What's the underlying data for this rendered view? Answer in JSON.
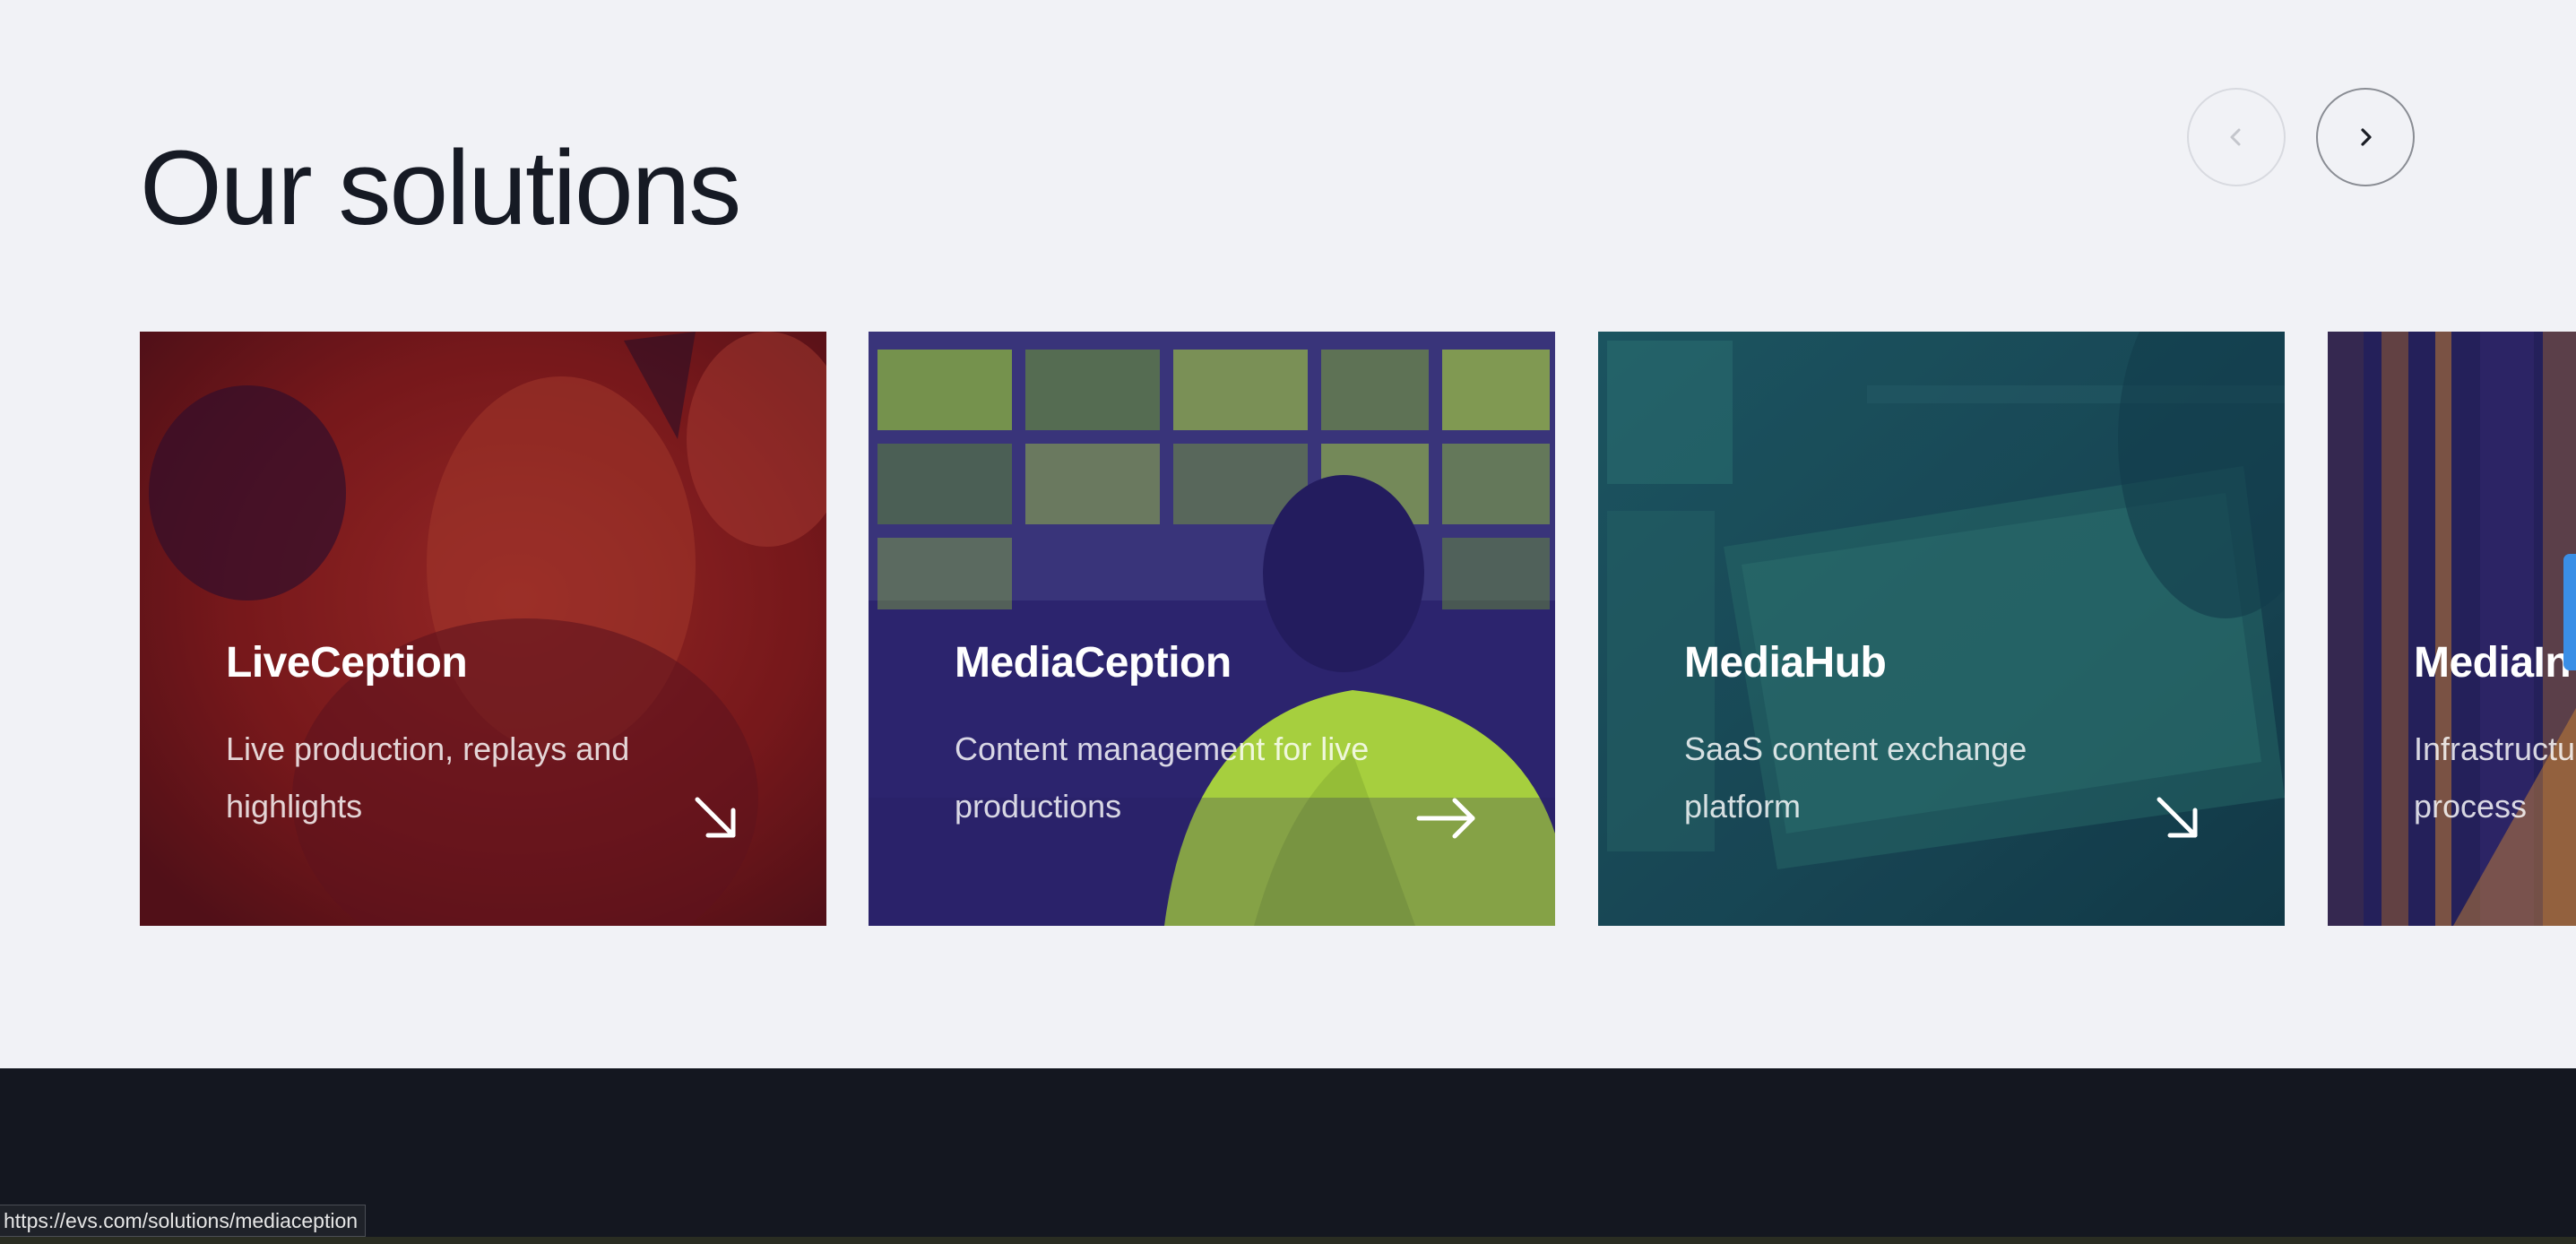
{
  "section": {
    "title": "Our solutions",
    "nav": {
      "prev_icon": "chevron-left-icon",
      "next_icon": "chevron-right-icon"
    }
  },
  "cards": [
    {
      "title": "LiveCeption",
      "description": "Live production, replays and highlights",
      "arrow_icon": "arrow-down-right-icon",
      "tint": "#8c1a1a"
    },
    {
      "title": "MediaCeption",
      "description": "Content management for live productions",
      "arrow_icon": "arrow-right-icon",
      "tint": "#2c246e",
      "highlight": "#a6cf3e"
    },
    {
      "title": "MediaHub",
      "description": "SaaS content exchange platform",
      "arrow_icon": "arrow-down-right-icon",
      "tint": "#1c4d5a"
    },
    {
      "title": "MediaIn",
      "description": "Infrastructu and process",
      "tint": "#24205a"
    }
  ],
  "status_bar": {
    "url": "https://evs.com/solutions/mediaception"
  }
}
